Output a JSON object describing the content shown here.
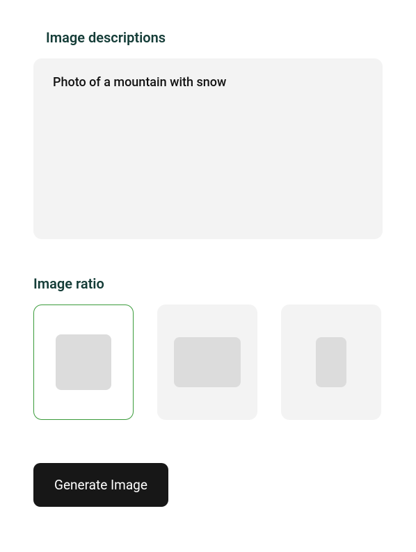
{
  "descriptions": {
    "title": "Image descriptions",
    "value": "Photo of a mountain with snow"
  },
  "ratio": {
    "title": "Image ratio",
    "options": [
      {
        "shape": "square",
        "selected": true
      },
      {
        "shape": "landscape",
        "selected": false
      },
      {
        "shape": "portrait",
        "selected": false
      }
    ]
  },
  "generate": {
    "label": "Generate Image"
  }
}
